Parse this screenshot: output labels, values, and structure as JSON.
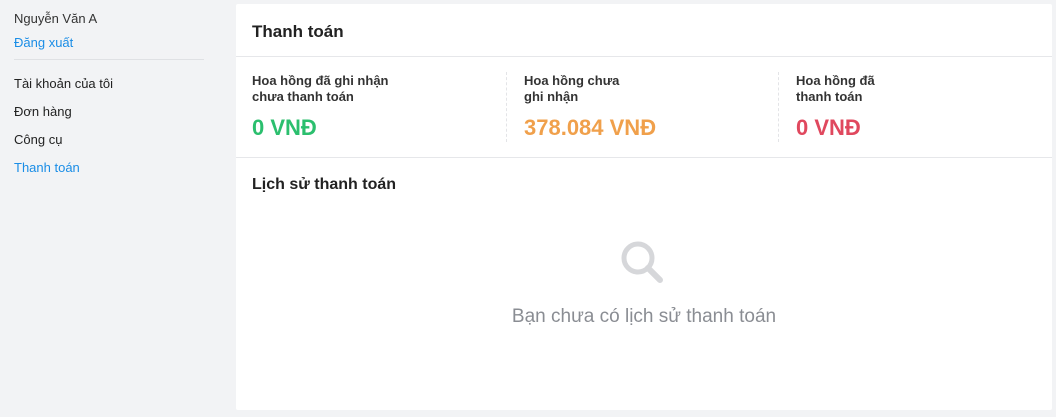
{
  "sidebar": {
    "user_name": "Nguyễn Văn A",
    "logout_label": "Đăng xuất",
    "items": [
      {
        "label": "Tài khoản của tôi"
      },
      {
        "label": "Đơn hàng"
      },
      {
        "label": "Công cụ"
      },
      {
        "label": "Thanh toán"
      }
    ],
    "active_item": "Thanh toán"
  },
  "main": {
    "title": "Thanh toán",
    "stats": [
      {
        "label": "Hoa hồng đã ghi nhận\nchưa thanh toán",
        "value": "0 VNĐ",
        "color": "#2bbf6e"
      },
      {
        "label": "Hoa hồng chưa\nghi nhận",
        "value": "378.084 VNĐ",
        "color": "#f0a04b"
      },
      {
        "label": "Hoa hồng đã\nthanh toán",
        "value": "0 VNĐ",
        "color": "#e0485e"
      }
    ],
    "history_title": "Lịch sử thanh toán",
    "empty_icon": "search-icon",
    "empty_text": "Bạn chưa có lịch sử thanh toán"
  },
  "colors": {
    "link": "#1a8de6",
    "background": "#f2f3f5"
  }
}
